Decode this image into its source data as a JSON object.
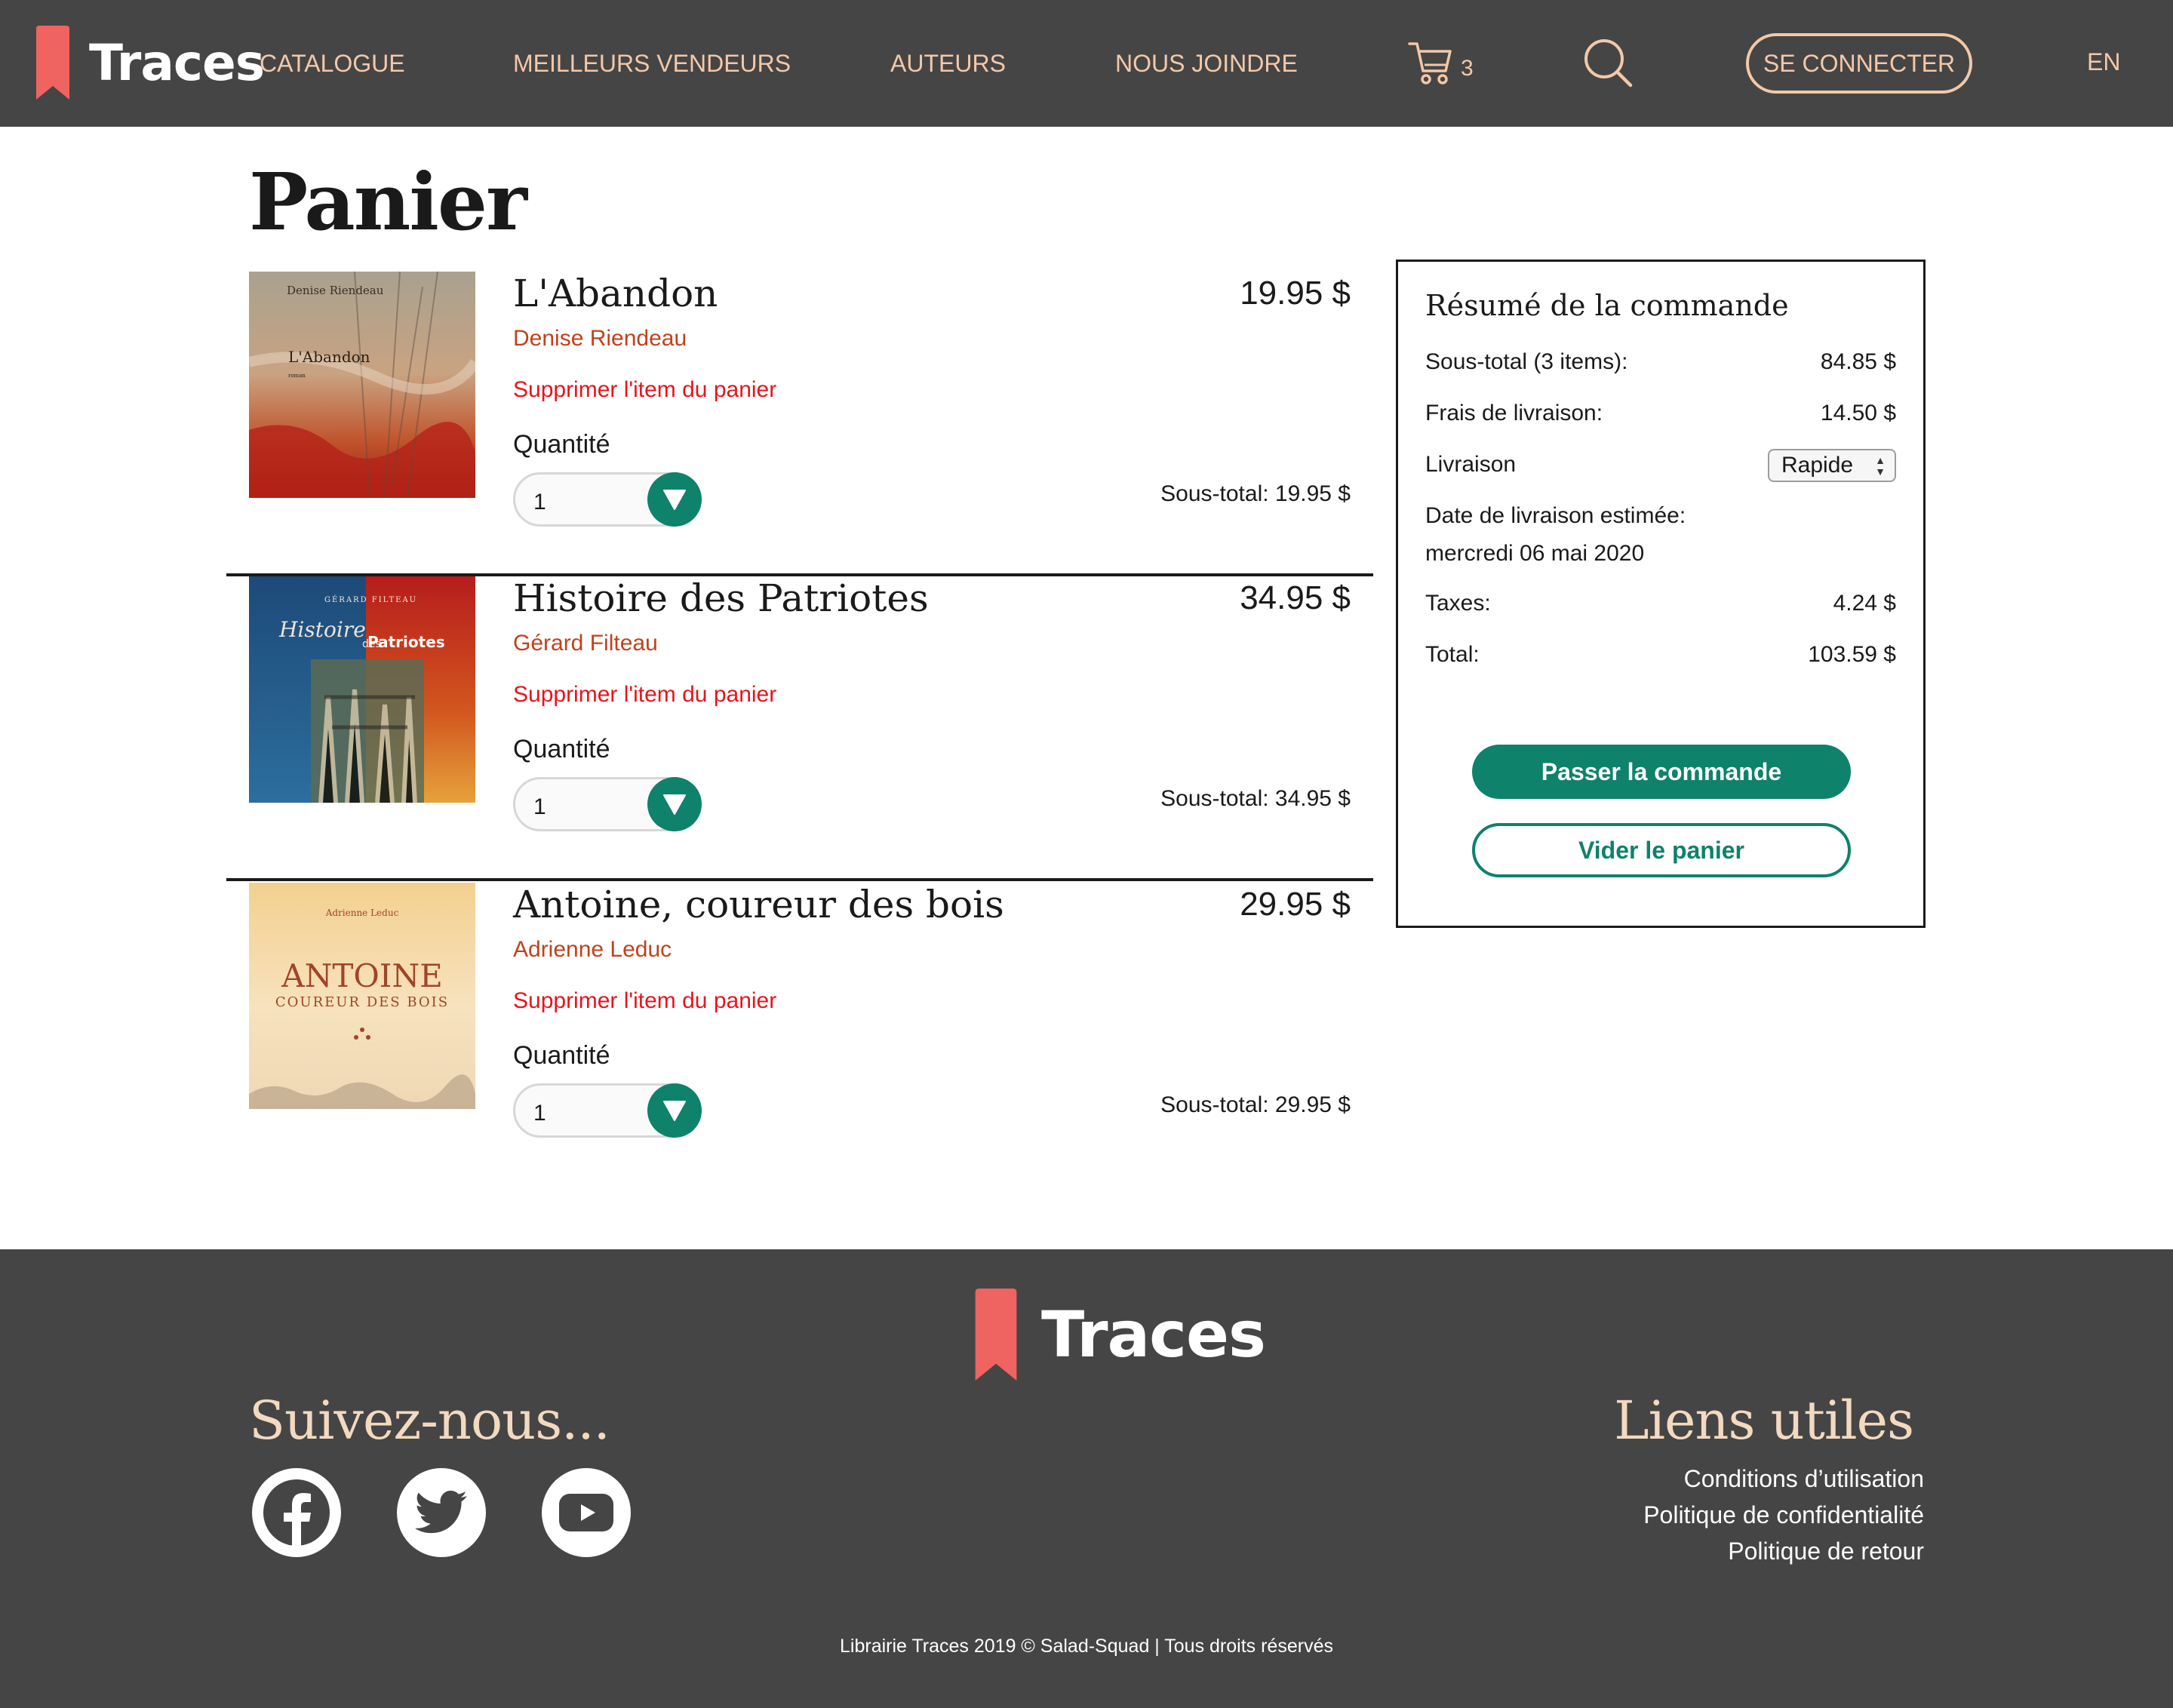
{
  "header": {
    "brand": "Traces",
    "nav": {
      "catalogue": "CATALOGUE",
      "bestsellers": "MEILLEURS VENDEURS",
      "authors": "AUTEURS",
      "contact": "NOUS JOINDRE"
    },
    "cart_count": "3",
    "login_label": "SE CONNECTER",
    "language": "EN"
  },
  "page_title": "Panier",
  "cart": {
    "items": [
      {
        "title": "L'Abandon",
        "author": "Denise Riendeau",
        "remove_label": "Supprimer l'item du panier",
        "quantity_label": "Quantité",
        "quantity": "1",
        "price": "19.95 $",
        "subtotal": "Sous-total: 19.95 $",
        "cover": {
          "author_text": "Denise Riendeau",
          "title_text": "L'Abandon",
          "sub_text": "roman"
        }
      },
      {
        "title": "Histoire des Patriotes",
        "author": "Gérard Filteau",
        "remove_label": "Supprimer l'item du panier",
        "quantity_label": "Quantité",
        "quantity": "1",
        "price": "34.95 $",
        "subtotal": "Sous-total: 34.95 $",
        "cover": {
          "author_text": "GÉRARD FILTEAU",
          "title_text_1": "Histoire",
          "title_text_2": "des",
          "title_text_3": "Patriotes"
        }
      },
      {
        "title": "Antoine, coureur des bois",
        "author": "Adrienne Leduc",
        "remove_label": "Supprimer l'item du panier",
        "quantity_label": "Quantité",
        "quantity": "1",
        "price": "29.95 $",
        "subtotal": "Sous-total: 29.95 $",
        "cover": {
          "author_text": "Adrienne Leduc",
          "title_text": "ANTOINE",
          "sub_text": "COUREUR DES BOIS"
        }
      }
    ]
  },
  "summary": {
    "title": "Résumé de la commande",
    "subtotal_label": "Sous-total (3 items):",
    "subtotal_value": "84.85 $",
    "shipping_label": "Frais de livraison:",
    "shipping_value": "14.50 $",
    "delivery_label": "Livraison",
    "delivery_selected": "Rapide",
    "estimated_label": "Date de livraison estimée:",
    "estimated_value": "mercredi 06 mai 2020",
    "taxes_label": "Taxes:",
    "taxes_value": "4.24 $",
    "total_label": "Total:",
    "total_value": "103.59 $",
    "order_button": "Passer la commande",
    "empty_button": "Vider le panier"
  },
  "footer": {
    "brand": "Traces",
    "follow_title": "Suivez-nous...",
    "social": [
      "facebook",
      "twitter",
      "youtube"
    ],
    "links_title": "Liens utiles",
    "links": [
      "Conditions d’utilisation",
      "Politique de confidentialité",
      "Politique de retour"
    ],
    "copyright": "Librairie Traces 2019 © Salad-Squad | Tous droits réservés"
  },
  "colors": {
    "header_bg": "#454545",
    "nav_text": "#f3c8a8",
    "accent_green": "#0e826b",
    "author_red": "#c0421c",
    "remove_red": "#e8141c",
    "bookmark": "#ef6360",
    "footer_heading": "#f3d9bf"
  }
}
